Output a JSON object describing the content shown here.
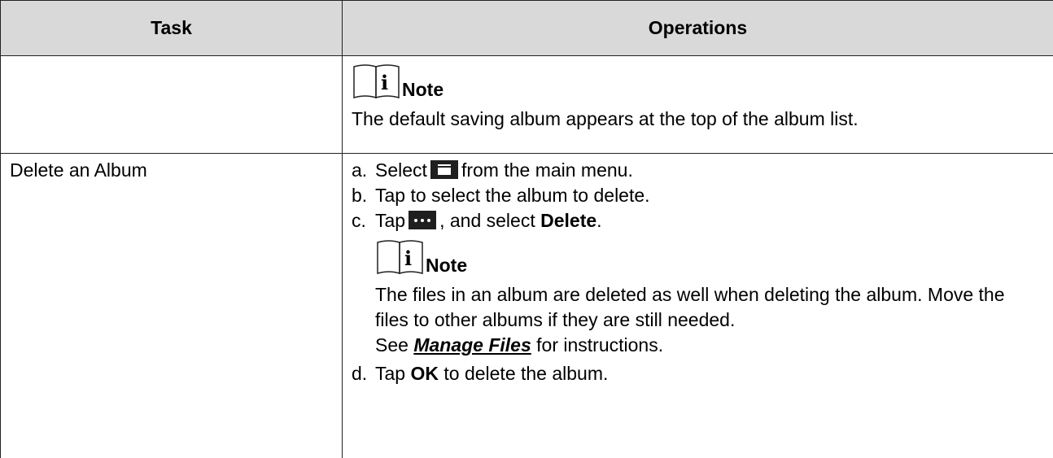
{
  "table": {
    "headers": {
      "task": "Task",
      "operations": "Operations"
    },
    "row1": {
      "task": "",
      "note_label": "Note",
      "note_text": "The default saving album appears at the top of the album list."
    },
    "row2": {
      "task": "Delete an Album",
      "steps": {
        "a_marker": "a.",
        "a_before": "Select",
        "a_after": "from the main menu.",
        "b_marker": "b.",
        "b_text": "Tap to select the album to delete.",
        "c_marker": "c.",
        "c_before": "Tap",
        "c_middle": ", and select",
        "c_bold": "Delete",
        "c_end": ".",
        "d_marker": "d.",
        "d_before": "Tap",
        "d_bold": "OK",
        "d_after": "to delete the album."
      },
      "note_label": "Note",
      "note_text_1": "The files in an album are deleted as well when deleting the album. Move the files to other albums if they are still needed.",
      "note_see": "See",
      "note_link": "Manage Files",
      "note_after": "for instructions."
    }
  },
  "icons": {
    "note": "note-book-info-icon",
    "album": "album-folder-icon",
    "more": "more-dots-icon"
  }
}
